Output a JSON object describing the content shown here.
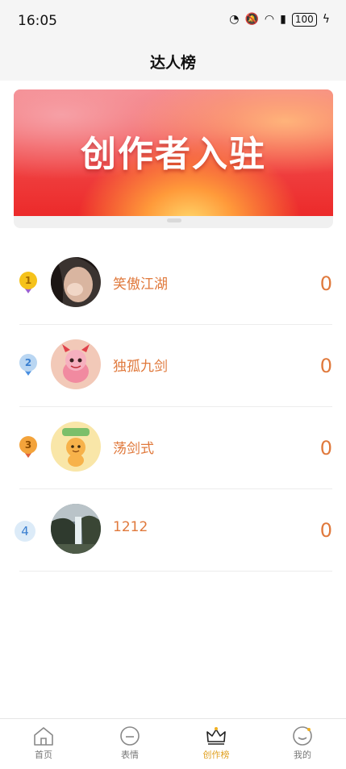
{
  "status_bar": {
    "time": "16:05",
    "battery": "100"
  },
  "nav": {
    "title": "达人榜"
  },
  "banner": {
    "title": "创作者入驻"
  },
  "ranking": [
    {
      "rank": "1",
      "name": "笑傲江湖",
      "score": "0",
      "medal_color": "#f5c21b",
      "ribbon_color": "#9b5fd0"
    },
    {
      "rank": "2",
      "name": "独孤九剑",
      "score": "0",
      "medal_color": "#b9d6f2",
      "ribbon_color": "#4a8fe0"
    },
    {
      "rank": "3",
      "name": "荡剑式",
      "score": "0",
      "medal_color": "#f3a33b",
      "ribbon_color": "#e0623c"
    },
    {
      "rank": "4",
      "name": "1212",
      "score": "0"
    }
  ],
  "tab_bar": {
    "items": [
      {
        "label": "首页",
        "icon": "home-icon"
      },
      {
        "label": "表情",
        "icon": "emoji-icon"
      },
      {
        "label": "创作榜",
        "icon": "crown-icon"
      },
      {
        "label": "我的",
        "icon": "profile-icon"
      }
    ],
    "active_index": 2,
    "active_color": "#e0a020"
  }
}
